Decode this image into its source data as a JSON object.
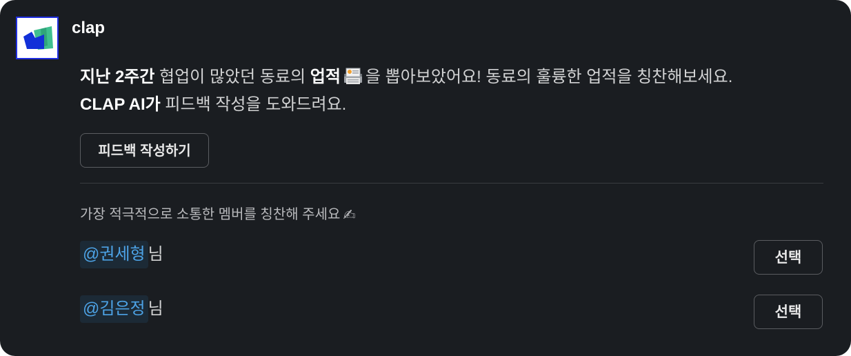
{
  "app": {
    "name": "clap",
    "icon": "clap-logo-icon"
  },
  "message": {
    "line1_bold1": "지난 2주간",
    "line1_text1": " 협업이 많았던 동료의 ",
    "line1_bold2": "업적",
    "line1_emoji": "ledger-emoji-icon",
    "line1_text2": "을 뽑아보았어요! 동료의 훌륭한 업적을 칭찬해보세요.",
    "line2_bold": "CLAP AI가",
    "line2_text": " 피드백 작성을 도와드려요."
  },
  "feedback_button": {
    "label": "피드백 작성하기"
  },
  "prompt": {
    "text": "가장 적극적으로 소통한 멤버를 칭찬해 주세요",
    "emoji": "✍"
  },
  "members": [
    {
      "mention": "@권세형",
      "suffix": "님",
      "button_label": "선택"
    },
    {
      "mention": "@김은정",
      "suffix": "님",
      "button_label": "선택"
    }
  ],
  "colors": {
    "background": "#1a1d21",
    "mention_text": "#4da3e6",
    "mention_bg": "#1c2a36",
    "logo_border": "#1f2ee0",
    "logo_blue": "#1230d8",
    "logo_green": "#3fbf8f"
  }
}
